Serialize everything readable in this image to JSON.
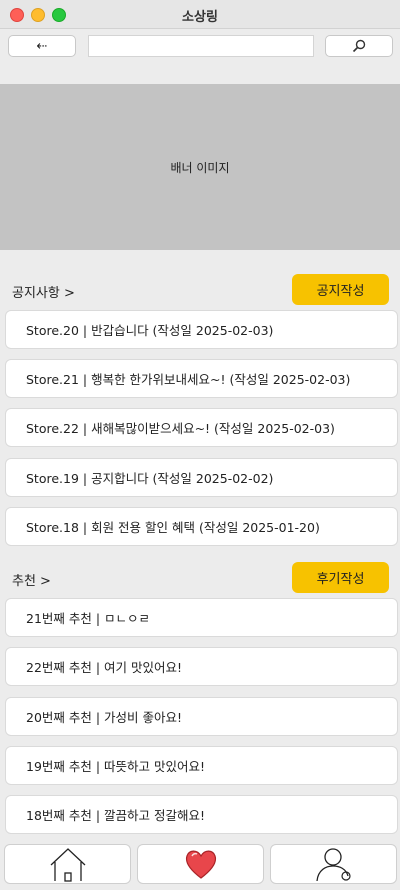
{
  "window": {
    "title": "소상링"
  },
  "toolbar": {
    "back_label": "⇠",
    "search_value": "",
    "search_placeholder": "",
    "search_icon": "magnifier-icon"
  },
  "banner": {
    "label": "배너 이미지"
  },
  "notices": {
    "header": "공지사항 >",
    "write_button": "공지작성",
    "items": [
      "Store.20 | 반갑습니다 (작성일 2025-02-03)",
      "Store.21 | 행복한 한가위보내세요~! (작성일 2025-02-03)",
      "Store.22 | 새해복많이받으세요~! (작성일 2025-02-03)",
      "Store.19 | 공지합니다 (작성일 2025-02-02)",
      "Store.18 | 회원 전용 할인 혜택 (작성일 2025-01-20)"
    ]
  },
  "recommend": {
    "header": "추천 >",
    "write_button": "후기작성",
    "items": [
      "21번째 추천 | ㅁㄴㅇㄹ",
      "22번째 추천 | 여기 맛있어요!",
      "20번째 추천 | 가성비 좋아요!",
      "19번째 추천 | 따뜻하고 맛있어요!",
      "18번째 추천 | 깔끔하고 정갈해요!"
    ]
  },
  "tabs": [
    {
      "icon": "home-icon"
    },
    {
      "icon": "heart-icon",
      "color": "#e8464b"
    },
    {
      "icon": "user-icon"
    }
  ]
}
